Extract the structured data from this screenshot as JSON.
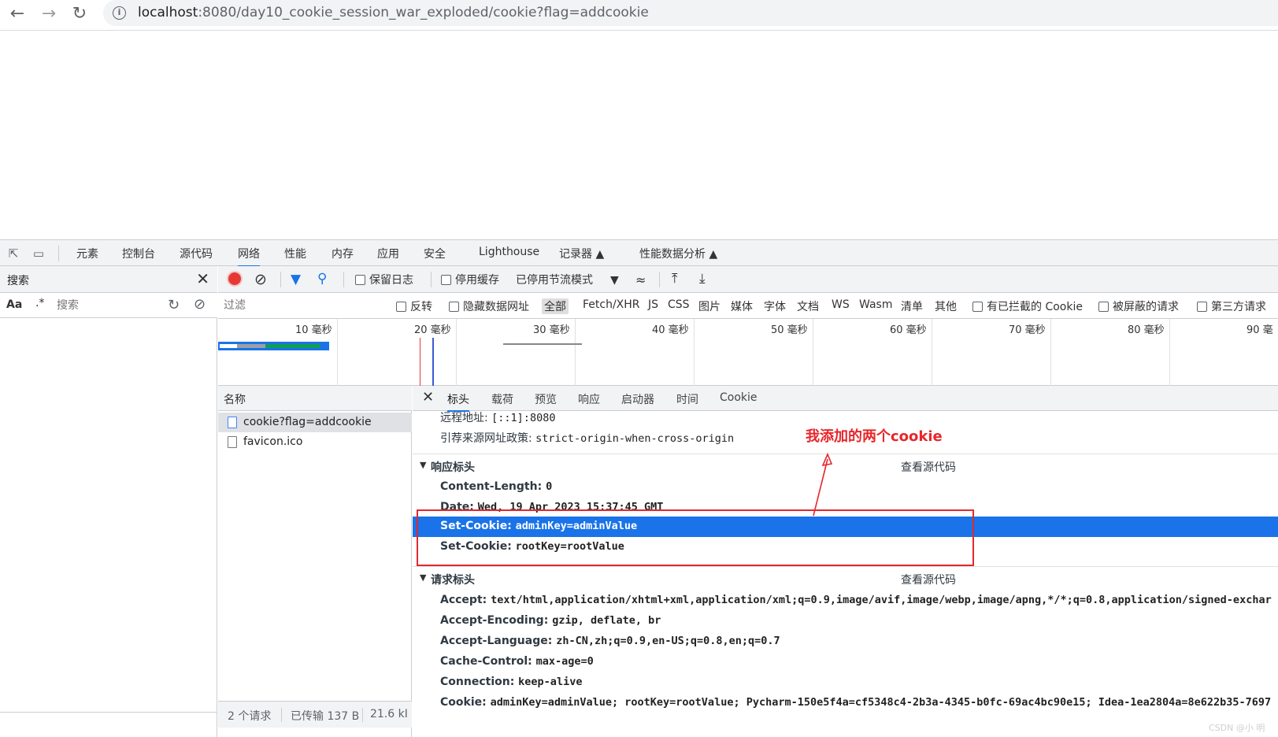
{
  "browser": {
    "back_icon": "arrow-left-icon",
    "forward_icon": "arrow-right-icon",
    "reload_icon": "reload-icon",
    "url_host": "localhost",
    "url_rest": ":8080/day10_cookie_session_war_exploded/cookie?flag=addcookie"
  },
  "devtools": {
    "tabs": [
      "元素",
      "控制台",
      "源代码",
      "网络",
      "性能",
      "内存",
      "应用",
      "安全",
      "Lighthouse",
      "记录器",
      "性能数据分析"
    ],
    "active_tab": "网络",
    "search_panel": {
      "title": "搜索",
      "aa": "Aa",
      "regex": ".*",
      "placeholder": "搜索"
    },
    "toolbar": {
      "preserve_log": "保留日志",
      "disable_cache": "停用缓存",
      "throttling": "已停用节流模式"
    },
    "filter": {
      "placeholder": "过滤",
      "invert": "反转",
      "hide_data_urls": "隐藏数据网址",
      "types": [
        "全部",
        "Fetch/XHR",
        "JS",
        "CSS",
        "图片",
        "媒体",
        "字体",
        "文档",
        "WS",
        "Wasm",
        "清单",
        "其他"
      ],
      "blocked_cookies": "有已拦截的 Cookie",
      "blocked_requests": "被屏蔽的请求",
      "third_party": "第三方请求"
    },
    "timeline_ticks": [
      "10 毫秒",
      "20 毫秒",
      "30 毫秒",
      "40 毫秒",
      "50 毫秒",
      "60 毫秒",
      "70 毫秒",
      "80 毫秒",
      "90 毫"
    ],
    "request_list": {
      "header": "名称",
      "rows": [
        "cookie?flag=addcookie",
        "favicon.ico"
      ],
      "status": [
        "2 个请求",
        "已传输 137 B",
        "21.6 kI"
      ]
    },
    "detail_tabs": [
      "标头",
      "载荷",
      "预览",
      "响应",
      "启动器",
      "时间",
      "Cookie"
    ],
    "general": [
      {
        "k": "远程地址:",
        "v": "[::1]:8080"
      },
      {
        "k": "引荐来源网址政策:",
        "v": "strict-origin-when-cross-origin"
      }
    ],
    "response_headers": {
      "title": "响应标头",
      "view_source": "查看源代码",
      "items": [
        {
          "k": "Content-Length:",
          "v": "0"
        },
        {
          "k": "Date:",
          "v": "Wed, 19 Apr 2023 15:37:45 GMT"
        },
        {
          "k": "Set-Cookie:",
          "v": "adminKey=adminValue"
        },
        {
          "k": "Set-Cookie:",
          "v": "rootKey=rootValue"
        }
      ]
    },
    "request_headers": {
      "title": "请求标头",
      "view_source": "查看源代码",
      "items": [
        {
          "k": "Accept:",
          "v": "text/html,application/xhtml+xml,application/xml;q=0.9,image/avif,image/webp,image/apng,*/*;q=0.8,application/signed-exchar"
        },
        {
          "k": "Accept-Encoding:",
          "v": "gzip, deflate, br"
        },
        {
          "k": "Accept-Language:",
          "v": "zh-CN,zh;q=0.9,en-US;q=0.8,en;q=0.7"
        },
        {
          "k": "Cache-Control:",
          "v": "max-age=0"
        },
        {
          "k": "Connection:",
          "v": "keep-alive"
        },
        {
          "k": "Cookie:",
          "v": "adminKey=adminValue; rootKey=rootValue; Pycharm-150e5f4a=cf5348c4-2b3a-4345-b0fc-69ac4bc90e15; Idea-1ea2804a=8e622b35-7697"
        }
      ]
    }
  },
  "annotation": "我添加的两个cookie",
  "watermark": "CSDN @小 明",
  "colors": {
    "highlight": "#1a73e8",
    "annotation": "#e8262b",
    "record": "#e53935"
  }
}
